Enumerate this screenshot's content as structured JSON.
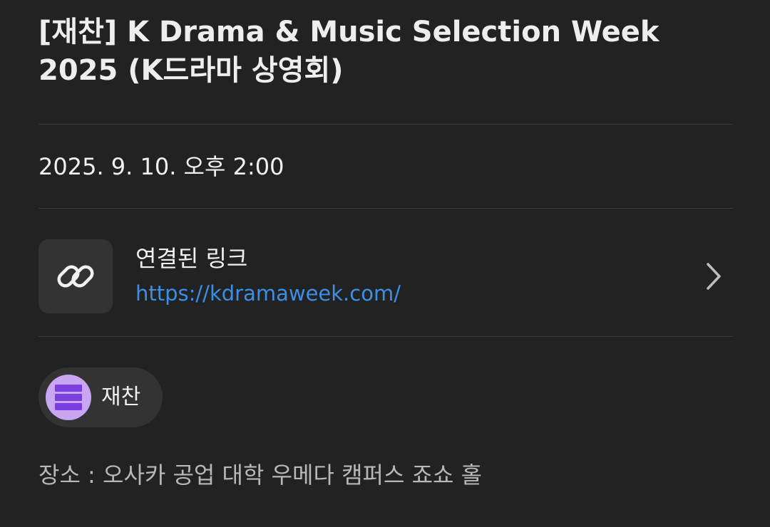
{
  "event": {
    "title": "[재찬] K Drama & Music Selection Week 2025 (K드라마 상영회)",
    "datetime": "2025. 9. 10. 오후 2:00",
    "link": {
      "label": "연결된 링크",
      "url": "https://kdramaweek.com/",
      "icon": "link-icon",
      "chevron_icon": "chevron-right-icon"
    },
    "calendar_chip": {
      "label": "재찬",
      "icon": "calendar-list-icon",
      "color": "#c9a6f2",
      "icon_color": "#7b3fe0"
    },
    "venue": "장소 : 오사카 공업 대학 우메다 캠퍼스 죠쇼 홀"
  },
  "colors": {
    "background": "#222222",
    "link_text": "#3b8fe6",
    "divider": "#3a3a3a",
    "surface": "#333333"
  }
}
